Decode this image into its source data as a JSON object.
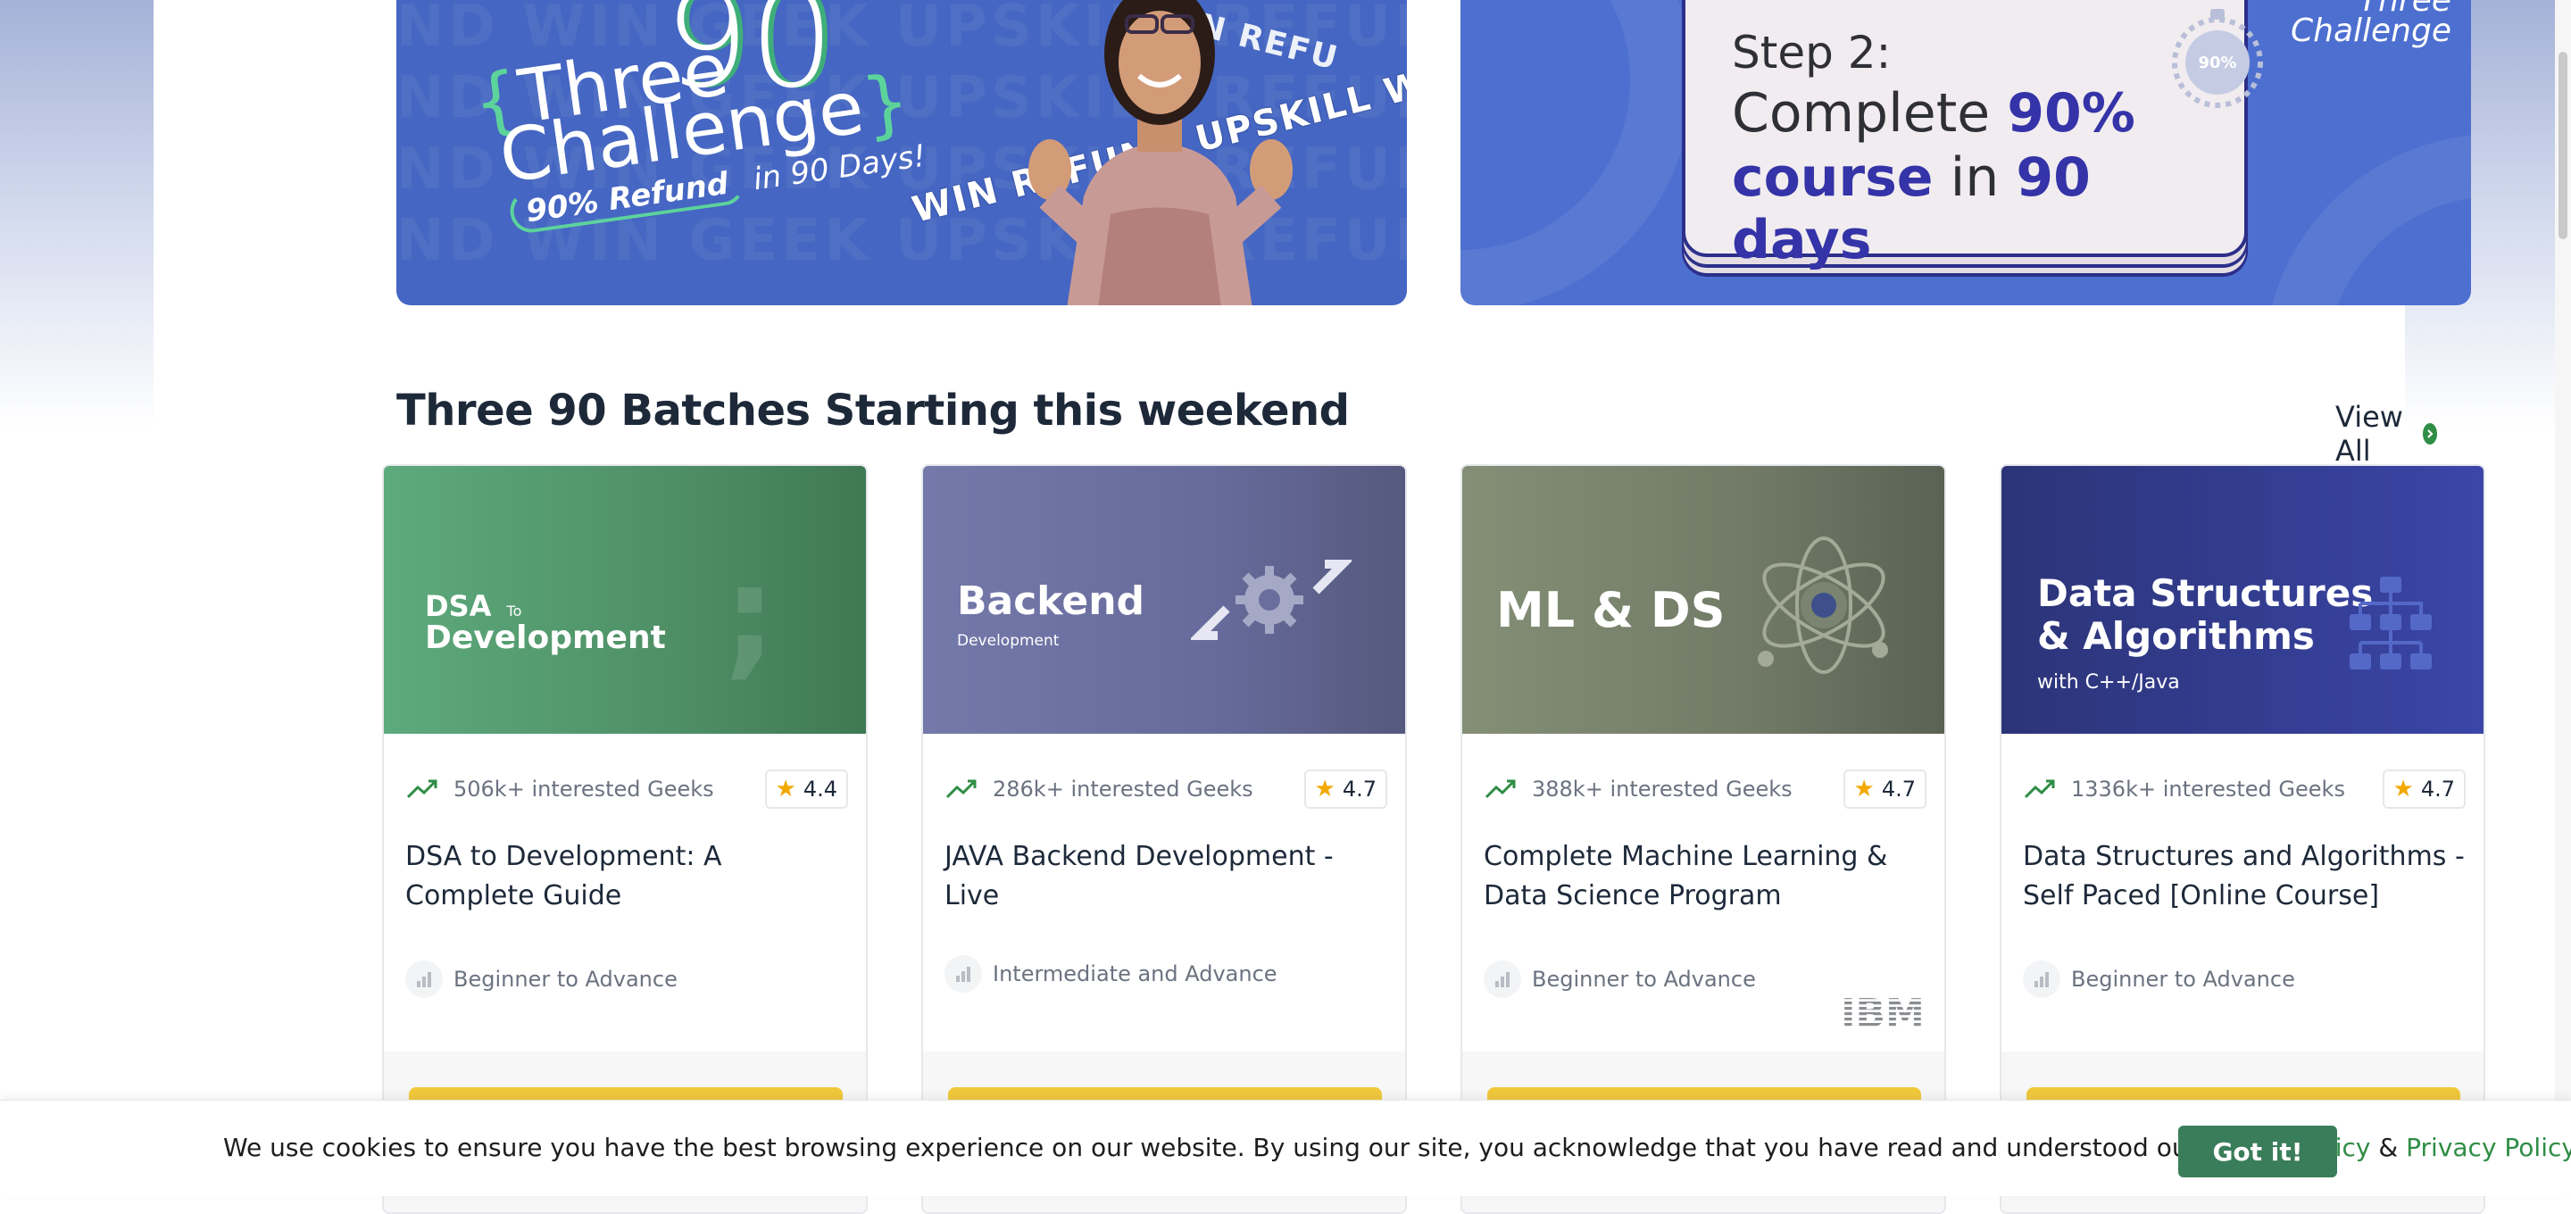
{
  "banners": {
    "challenge": {
      "ninety": "90",
      "three": "Three",
      "challenge": "Challenge",
      "refund_bold": "90% Refund",
      "refund_rest": "in 90 Days!",
      "band_words": "WIN REFUND UPSKILL WI",
      "band_words2": "WIN REFU",
      "bg_words": "ND WIN GEEK UPSKILL REFUND WIN"
    },
    "step": {
      "label": "Step 2:",
      "line1_prefix": "Complete ",
      "line1_highlight": "90%",
      "line2_highlight1": "course",
      "line2_mid": " in ",
      "line2_highlight2": "90 days",
      "stopwatch_text": "90%",
      "corner_line1": "Three",
      "corner_line2": "Challenge"
    }
  },
  "section": {
    "title": "Three 90 Batches Starting this weekend",
    "view_all": "View All"
  },
  "cards": [
    {
      "thumb_small": "DSA",
      "thumb_to": "To",
      "thumb_big": "Development",
      "interest": "506k+ interested Geeks",
      "rating": "4.4",
      "title": "DSA to Development: A Complete Guide",
      "level": "Beginner to Advance"
    },
    {
      "thumb_big": "Backend",
      "thumb_sub": "Development",
      "interest": "286k+ interested Geeks",
      "rating": "4.7",
      "title": "JAVA Backend Development - Live",
      "level": "Intermediate and Advance"
    },
    {
      "thumb_big": "ML & DS",
      "interest": "388k+ interested Geeks",
      "rating": "4.7",
      "title": "Complete Machine Learning & Data Science Program",
      "level": "Beginner to Advance",
      "partner_logo": "IBM"
    },
    {
      "thumb_big_line1": "Data Structures",
      "thumb_big_line2": "& Algorithms",
      "thumb_sub": "with C++/Java",
      "interest": "1336k+ interested Geeks",
      "rating": "4.7",
      "title": "Data Structures and Algorithms - Self Paced [Online Course]",
      "level": "Beginner to Advance"
    }
  ],
  "cookie": {
    "text": "We use cookies to ensure you have the best browsing experience on our website. By using our site, you acknowledge that you have read and understood our ",
    "cookie_policy": "Cookie Policy",
    "amp": " & ",
    "privacy_policy": "Privacy Policy",
    "button": "Got it!"
  },
  "colors": {
    "brand_green": "#2f8d46",
    "cta_yellow": "#f0c93c",
    "heading": "#1d2939"
  },
  "icons": {
    "trend": "trending-up-icon",
    "level": "bar-chart-icon",
    "star": "star-icon",
    "view_all": "chevron-right-circle-icon"
  }
}
